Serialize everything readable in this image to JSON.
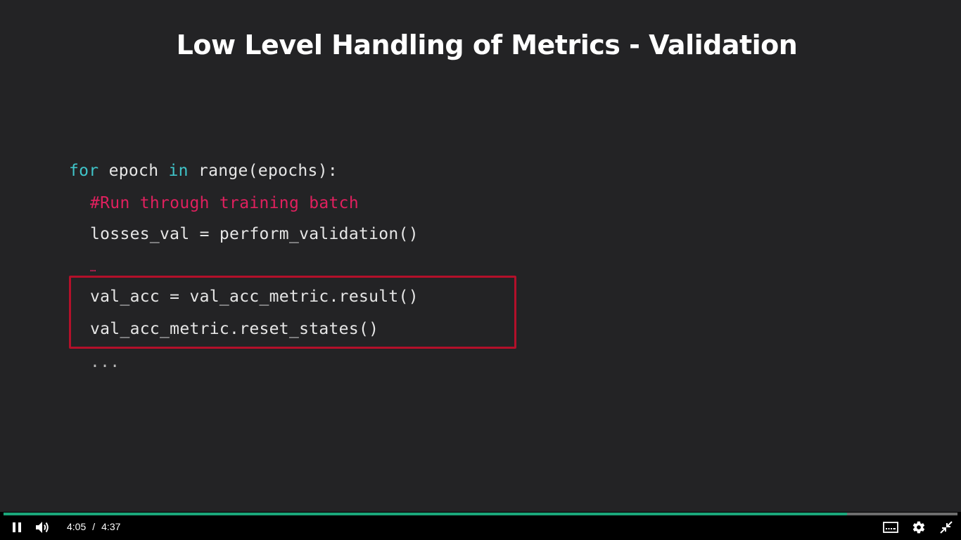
{
  "slide": {
    "title": "Low Level Handling of Metrics - Validation",
    "code": {
      "line1_kw_for": "for",
      "line1_mid": " epoch ",
      "line1_kw_in": "in",
      "line1_rest": " range(epochs):",
      "line2_comment": "#Run through training batch",
      "line3": "losses_val = perform_validation()",
      "line4_ellipsis": "…",
      "line5": "val_acc = val_acc_metric.result()",
      "line6": "val_acc_metric.reset_states()",
      "line7": "..."
    },
    "colors": {
      "background": "#232325",
      "keyword": "#3fc4c9",
      "comment": "#e0205e",
      "highlight_border": "#b3102a"
    }
  },
  "player": {
    "current_time": "4:05",
    "separator": "/",
    "duration": "4:37",
    "progress_percent": 88.4,
    "icons": {
      "play_pause": "pause-icon",
      "volume": "volume-icon",
      "captions": "captions-icon",
      "settings": "gear-icon",
      "fullscreen": "exit-fullscreen-icon"
    },
    "colors": {
      "progress": "#1ba67a",
      "bar_background": "#000000"
    }
  }
}
